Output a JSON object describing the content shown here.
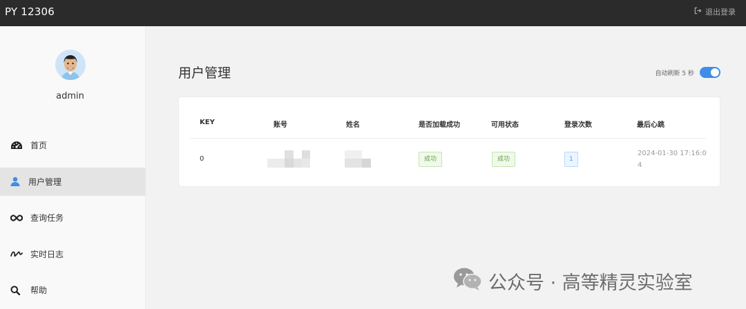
{
  "app": {
    "title": "PY 12306",
    "logout_label": "退出登录"
  },
  "user": {
    "name": "admin"
  },
  "sidebar": {
    "items": [
      {
        "label": "首页",
        "icon": "dashboard-icon",
        "active": false
      },
      {
        "label": "用户管理",
        "icon": "user-icon",
        "active": true
      },
      {
        "label": "查询任务",
        "icon": "infinity-icon",
        "active": false
      },
      {
        "label": "实时日志",
        "icon": "squiggle-icon",
        "active": false
      },
      {
        "label": "帮助",
        "icon": "search-icon",
        "active": false
      }
    ]
  },
  "main": {
    "title": "用户管理",
    "auto_refresh_label": "自动刷新 5 秒",
    "auto_refresh_enabled": true
  },
  "table": {
    "headers": [
      "KEY",
      "账号",
      "姓名",
      "是否加载成功",
      "可用状态",
      "登录次数",
      "最后心跳"
    ],
    "rows": [
      {
        "key": "0",
        "account": "",
        "name": "",
        "loaded": "成功",
        "status": "成功",
        "login_count": "1",
        "heartbeat": "2024-01-30 17:16:04"
      }
    ]
  },
  "colors": {
    "accent": "#3d8ee8",
    "topbar": "#2b2b2b",
    "success": "#67a443"
  },
  "watermark": {
    "text": "公众号 · 高等精灵实验室"
  }
}
